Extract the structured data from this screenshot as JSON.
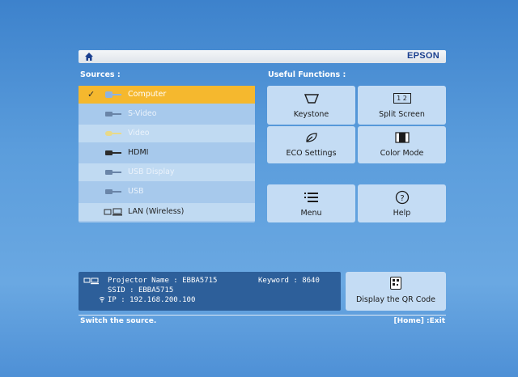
{
  "header": {
    "brand": "EPSON",
    "home_icon": "home-icon"
  },
  "sources": {
    "label": "Sources :",
    "items": [
      {
        "label": "Computer",
        "icon": "vga-connector-icon",
        "state": "selected"
      },
      {
        "label": "S-Video",
        "icon": "svideo-connector-icon",
        "state": "disabled"
      },
      {
        "label": "Video",
        "icon": "video-connector-icon",
        "state": "disabled"
      },
      {
        "label": "HDMI",
        "icon": "hdmi-connector-icon",
        "state": "enabled"
      },
      {
        "label": "USB Display",
        "icon": "usb-display-connector-icon",
        "state": "disabled"
      },
      {
        "label": "USB",
        "icon": "usb-connector-icon",
        "state": "disabled"
      },
      {
        "label": "LAN (Wireless)",
        "icon": "lan-icon",
        "state": "enabled"
      }
    ]
  },
  "useful": {
    "label": "Useful Functions :",
    "keystone": "Keystone",
    "split_screen": "Split Screen",
    "split_icon_text": "1 2",
    "eco": "ECO Settings",
    "color_mode": "Color Mode",
    "menu": "Menu",
    "help": "Help"
  },
  "info": {
    "projector_name_label": "Projector Name :",
    "projector_name": "EBBA5715",
    "ssid_label": "SSID :",
    "ssid": "EBBA5715",
    "ip_label": "IP :",
    "ip": "192.168.200.100",
    "keyword_label": "Keyword :",
    "keyword": "8640"
  },
  "qr": {
    "label": "Display the QR Code"
  },
  "status": {
    "hint": "Switch the source.",
    "exit": "[Home] :Exit"
  },
  "colors": {
    "selected": "#f5b82e",
    "panel": "#c4dcf4",
    "brand": "#1a3f8f"
  }
}
